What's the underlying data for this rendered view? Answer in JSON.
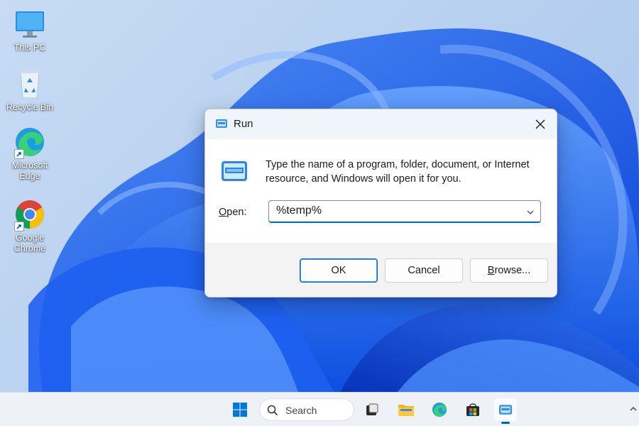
{
  "desktop": {
    "icons": [
      {
        "label": "This PC"
      },
      {
        "label": "Recycle Bin"
      },
      {
        "label": "Microsoft Edge"
      },
      {
        "label": "Google Chrome"
      }
    ]
  },
  "run_dialog": {
    "title": "Run",
    "description": "Type the name of a program, folder, document, or Internet resource, and Windows will open it for you.",
    "open_label_accel": "O",
    "open_label_rest": "pen:",
    "open_value": "%temp%",
    "buttons": {
      "ok": "OK",
      "cancel": "Cancel",
      "browse_accel": "B",
      "browse_rest": "rowse..."
    }
  },
  "taskbar": {
    "search_placeholder": "Search",
    "accent_color": "#0067c0"
  }
}
